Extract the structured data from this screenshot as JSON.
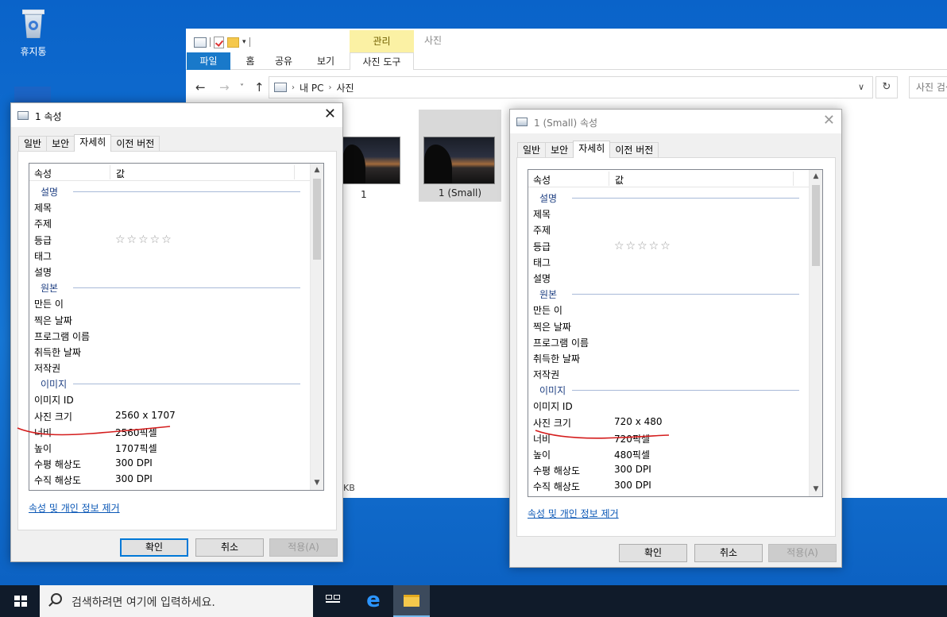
{
  "desktop": {
    "recycle_bin_label": "휴지통"
  },
  "explorer": {
    "ribbon_context_header": "관리",
    "window_title": "사진",
    "tabs": [
      {
        "label": "파일"
      },
      {
        "label": "홈"
      },
      {
        "label": "공유"
      },
      {
        "label": "보기"
      },
      {
        "label": "사진 도구"
      }
    ],
    "breadcrumb": [
      "내 PC",
      "사진"
    ],
    "search_placeholder": "사진 검색",
    "files": [
      {
        "name": "1",
        "selected": false
      },
      {
        "name": "1 (Small)",
        "selected": true
      }
    ],
    "status_fragment": "KB"
  },
  "dialog_left": {
    "title": "1 속성",
    "tabs": [
      "일반",
      "보안",
      "자세히",
      "이전 버전"
    ],
    "active_tab": "자세히",
    "col_property": "속성",
    "col_value": "값",
    "rows": [
      {
        "k": "설명",
        "v": "",
        "group": true
      },
      {
        "k": "제목",
        "v": ""
      },
      {
        "k": "주제",
        "v": ""
      },
      {
        "k": "등급",
        "v": "☆☆☆☆☆",
        "stars": true
      },
      {
        "k": "태그",
        "v": ""
      },
      {
        "k": "설명",
        "v": ""
      },
      {
        "k": "원본",
        "v": "",
        "group": true
      },
      {
        "k": "만든 이",
        "v": ""
      },
      {
        "k": "찍은 날짜",
        "v": ""
      },
      {
        "k": "프로그램 이름",
        "v": ""
      },
      {
        "k": "취득한 날짜",
        "v": ""
      },
      {
        "k": "저작권",
        "v": ""
      },
      {
        "k": "이미지",
        "v": "",
        "group": true
      },
      {
        "k": "이미지 ID",
        "v": ""
      },
      {
        "k": "사진 크기",
        "v": "2560 x 1707"
      },
      {
        "k": "너비",
        "v": "2560픽셀"
      },
      {
        "k": "높이",
        "v": "1707픽셀"
      },
      {
        "k": "수평 해상도",
        "v": "300 DPI"
      },
      {
        "k": "수직 해상도",
        "v": "300 DPI"
      }
    ],
    "remove_link": "속성 및 개인 정보 제거",
    "ok": "확인",
    "cancel": "취소",
    "apply": "적용(A)"
  },
  "dialog_right": {
    "title": "1 (Small) 속성",
    "tabs": [
      "일반",
      "보안",
      "자세히",
      "이전 버전"
    ],
    "active_tab": "자세히",
    "col_property": "속성",
    "col_value": "값",
    "rows": [
      {
        "k": "설명",
        "v": "",
        "group": true
      },
      {
        "k": "제목",
        "v": ""
      },
      {
        "k": "주제",
        "v": ""
      },
      {
        "k": "등급",
        "v": "☆☆☆☆☆",
        "stars": true
      },
      {
        "k": "태그",
        "v": ""
      },
      {
        "k": "설명",
        "v": ""
      },
      {
        "k": "원본",
        "v": "",
        "group": true
      },
      {
        "k": "만든 이",
        "v": ""
      },
      {
        "k": "찍은 날짜",
        "v": ""
      },
      {
        "k": "프로그램 이름",
        "v": ""
      },
      {
        "k": "취득한 날짜",
        "v": ""
      },
      {
        "k": "저작권",
        "v": ""
      },
      {
        "k": "이미지",
        "v": "",
        "group": true
      },
      {
        "k": "이미지 ID",
        "v": ""
      },
      {
        "k": "사진 크기",
        "v": "720 x 480"
      },
      {
        "k": "너비",
        "v": "720픽셀"
      },
      {
        "k": "높이",
        "v": "480픽셀"
      },
      {
        "k": "수평 해상도",
        "v": "300 DPI"
      },
      {
        "k": "수직 해상도",
        "v": "300 DPI"
      }
    ],
    "remove_link": "속성 및 개인 정보 제거",
    "ok": "확인",
    "cancel": "취소",
    "apply": "적용(A)"
  },
  "taskbar": {
    "search_placeholder": "검색하려면 여기에 입력하세요."
  },
  "colors": {
    "accent": "#0078d7",
    "ribbon_file_tab": "#1979ca",
    "annotation": "#d41c1c",
    "desktop": "#1677d6"
  },
  "icons": [
    "recycle-bin-icon",
    "edge-icon",
    "windows-logo-icon",
    "search-icon",
    "task-view-icon",
    "file-explorer-icon",
    "close-icon",
    "refresh-icon"
  ]
}
